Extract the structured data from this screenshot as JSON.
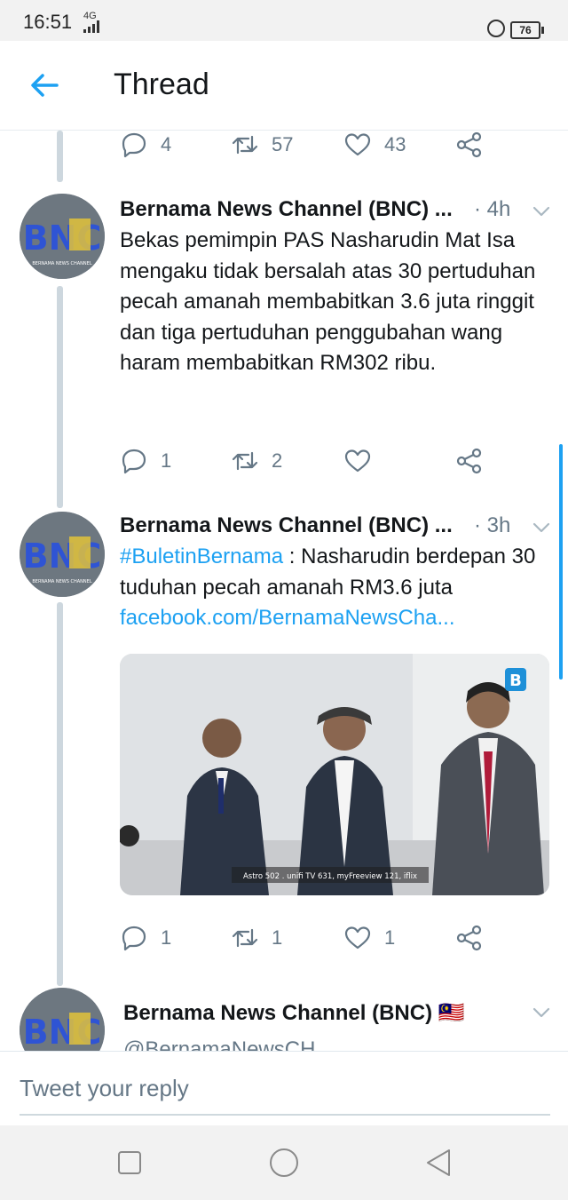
{
  "status_bar": {
    "time": "16:51",
    "network": "4G",
    "battery": "76"
  },
  "header": {
    "title": "Thread"
  },
  "top_actions": {
    "replies": "4",
    "retweets": "57",
    "likes": "43"
  },
  "tweets": [
    {
      "name": "Bernama News Channel (BNC) ...",
      "time": "· 4h",
      "text": "Bekas pemimpin PAS Nasharudin Mat Isa mengaku tidak bersalah atas 30 pertuduhan pecah amanah membabitkan 3.6 juta ringgit dan tiga pertuduhan penggubahan wang haram membabitkan RM302 ribu.",
      "replies": "1",
      "retweets": "2",
      "likes": ""
    },
    {
      "name": "Bernama News Channel (BNC) ...",
      "time": "· 3h",
      "hashtag": "#BuletinBernama",
      "text": " : Nasharudin berdepan 30 tuduhan pecah amanah RM3.6 juta",
      "link": "facebook.com/BernamaNewsCha...",
      "media_caption": "Astro 502 . unifi TV 631, myFreeview 121, iflix",
      "media_badge": "B",
      "replies": "1",
      "retweets": "1",
      "likes": "1"
    },
    {
      "name": "Bernama News Channel (BNC) 🇲🇾",
      "handle": "@BernamaNewsCH"
    }
  ],
  "avatar_logo": "BNC",
  "avatar_sub": "BERNAMA NEWS CHANNEL",
  "reply": {
    "placeholder": "Tweet your reply"
  },
  "colors": {
    "accent": "#1da1f2",
    "muted": "#657786",
    "thread_line": "#cdd7de"
  }
}
